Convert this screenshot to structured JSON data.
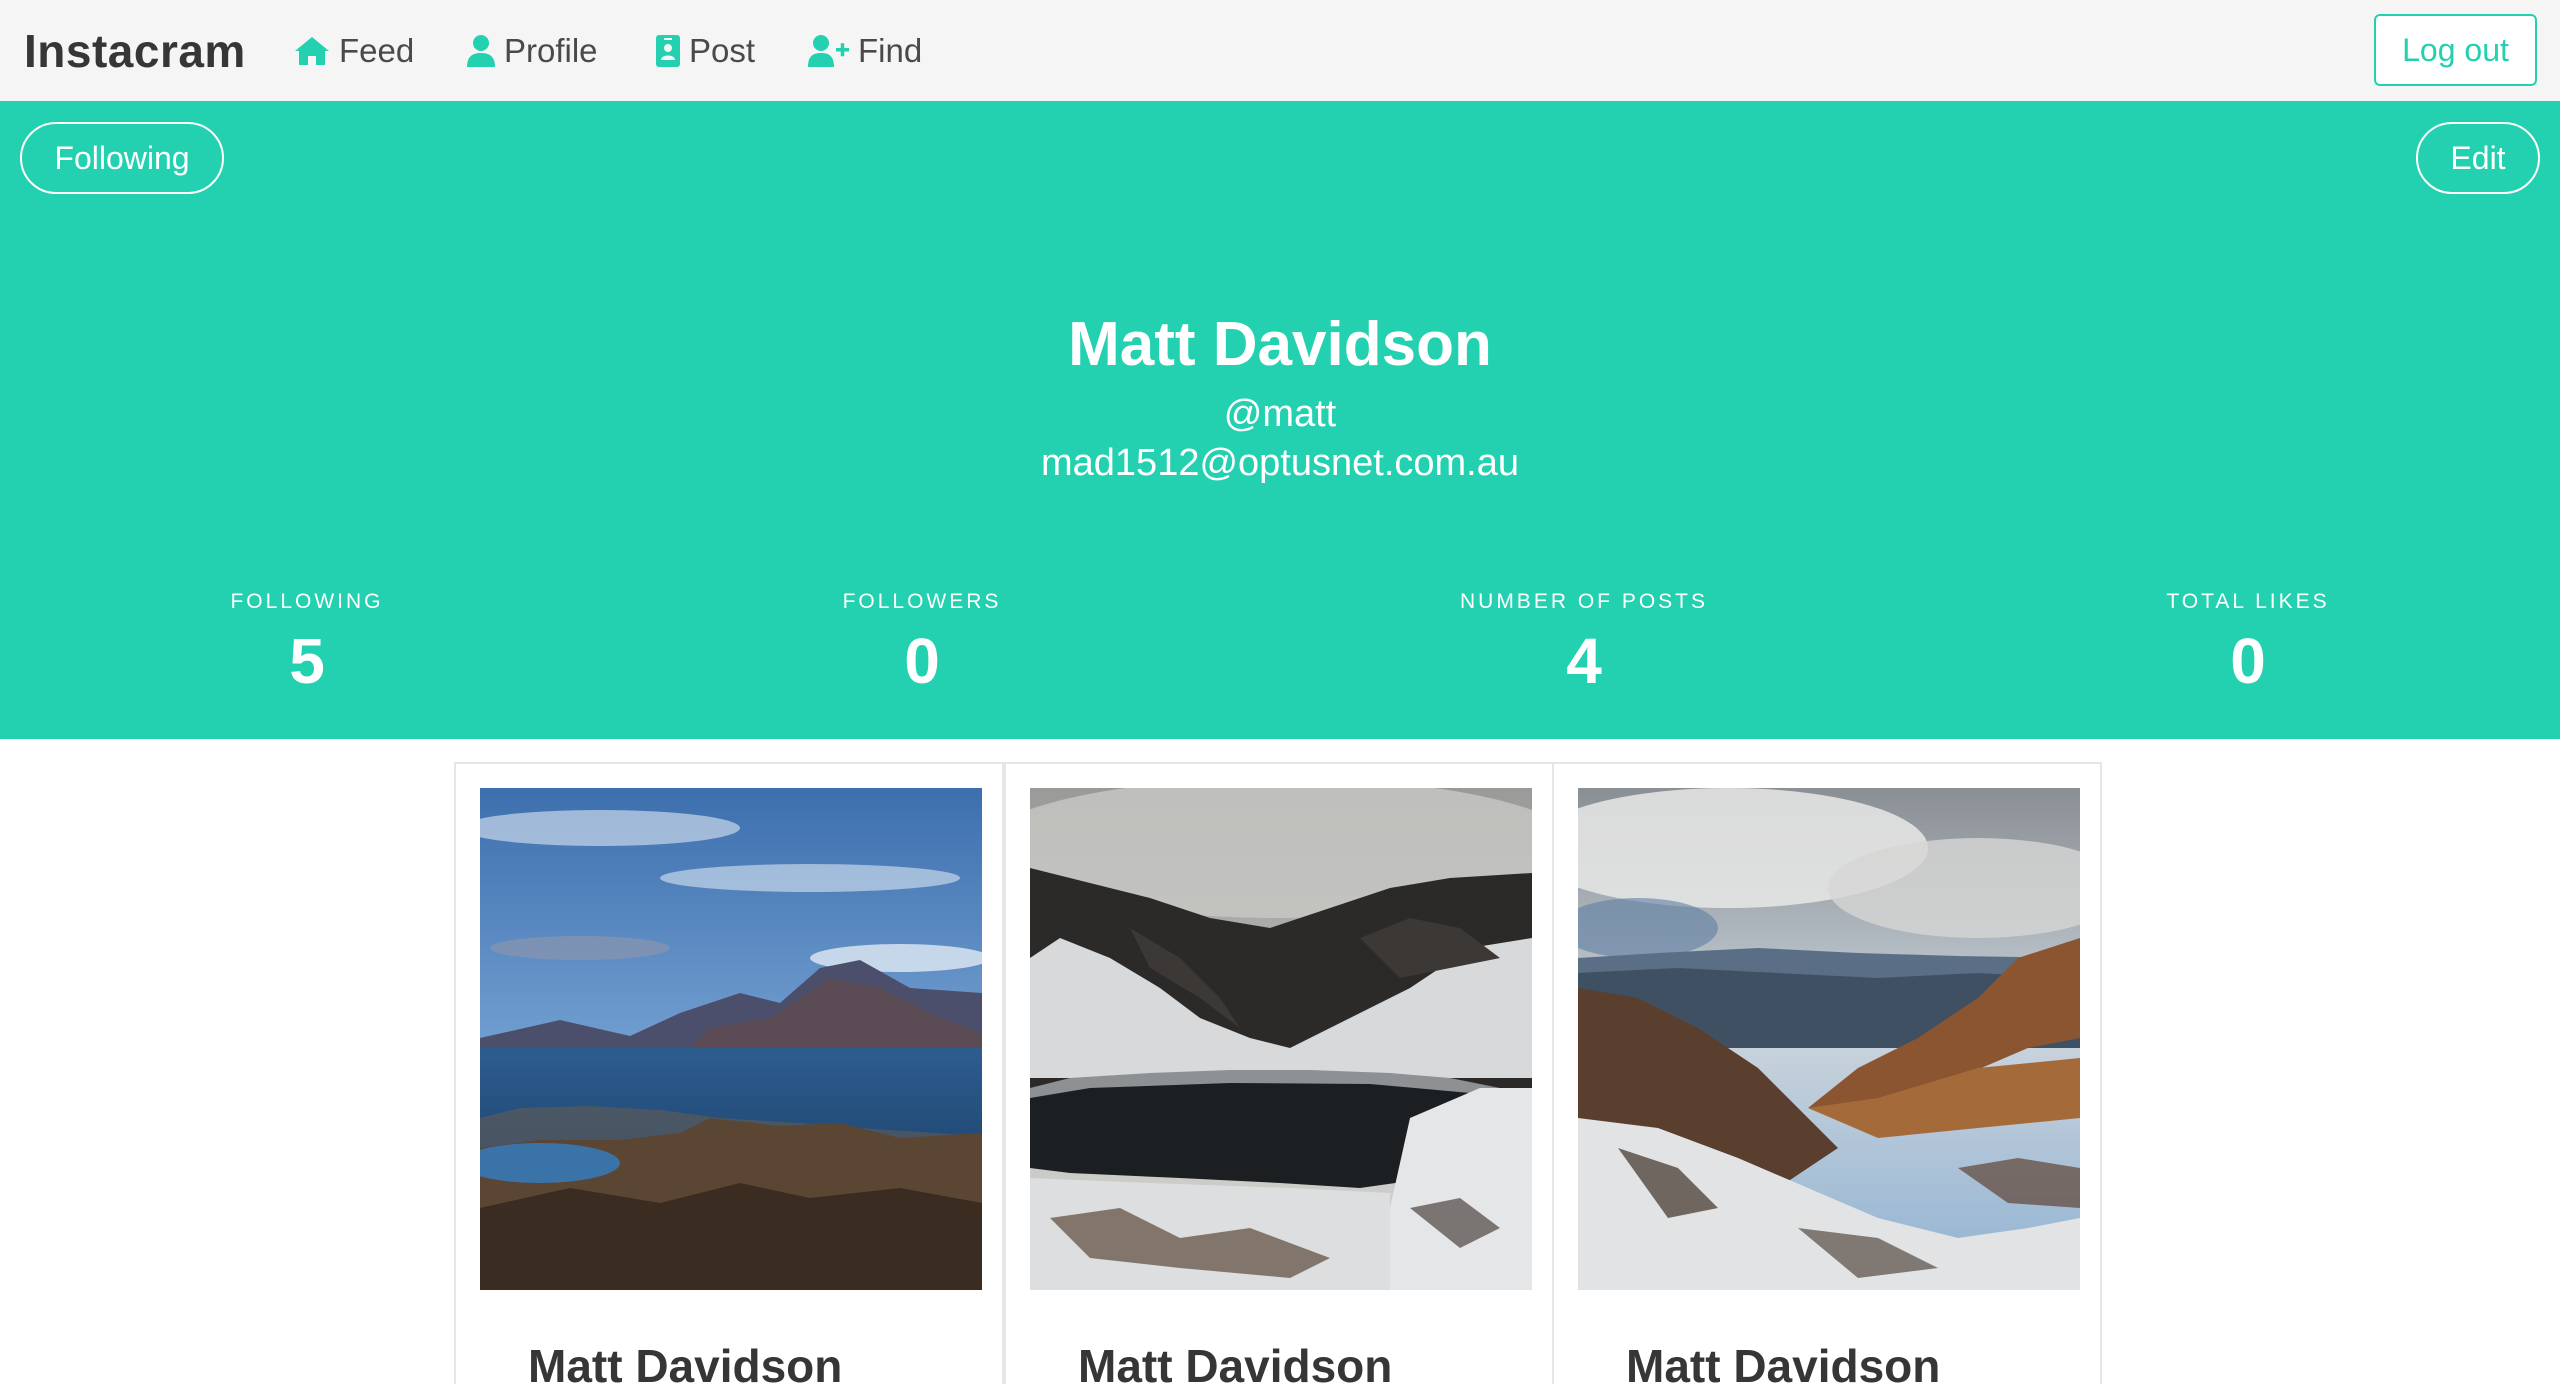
{
  "navbar": {
    "brand": "Instacram",
    "items": [
      {
        "label": "Feed",
        "icon": "home-icon"
      },
      {
        "label": "Profile",
        "icon": "user-icon"
      },
      {
        "label": "Post",
        "icon": "id-badge-icon"
      },
      {
        "label": "Find",
        "icon": "user-plus-icon"
      }
    ],
    "logout_label": "Log out"
  },
  "profile": {
    "following_button": "Following",
    "edit_button": "Edit",
    "name": "Matt Davidson",
    "handle": "@matt",
    "email": "mad1512@optusnet.com.au",
    "stats": [
      {
        "label": "FOLLOWING",
        "value": "5"
      },
      {
        "label": "FOLLOWERS",
        "value": "0"
      },
      {
        "label": "NUMBER OF POSTS",
        "value": "4"
      },
      {
        "label": "TOTAL LIKES",
        "value": "0"
      }
    ]
  },
  "posts": [
    {
      "author": "Matt Davidson",
      "image": "mountain-lake-landscape-photo"
    },
    {
      "author": "Matt Davidson",
      "image": "snowy-alpine-lake-photo"
    },
    {
      "author": "Matt Davidson",
      "image": "snowy-mountain-valley-photo"
    }
  ],
  "colors": {
    "accent": "#23d1b0",
    "navbar_bg": "#f5f5f5",
    "text_dark": "#363636"
  }
}
